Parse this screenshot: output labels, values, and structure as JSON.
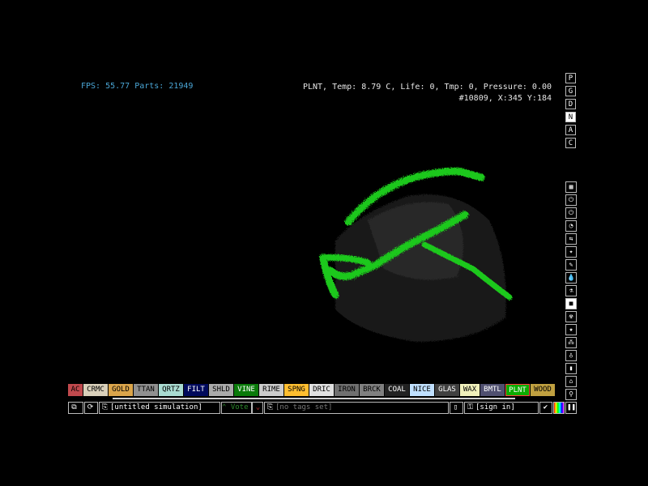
{
  "hud": {
    "fps_label": "FPS:",
    "fps_value": "55.77",
    "parts_label": "Parts:",
    "parts_value": "21949",
    "info_line1": "PLNT, Temp: 8.79 C, Life: 0, Tmp: 0, Pressure: 0.00",
    "info_line2": "#10809, X:345 Y:184"
  },
  "render_modes": [
    "P",
    "G",
    "D",
    "N",
    "A",
    "C"
  ],
  "categories": [
    {
      "name": "walls-icon",
      "glyph": "▦"
    },
    {
      "name": "electronics-icon",
      "glyph": "⏻"
    },
    {
      "name": "powered-icon",
      "glyph": "⏻"
    },
    {
      "name": "sensors-icon",
      "glyph": "◔"
    },
    {
      "name": "force-icon",
      "glyph": "⇆"
    },
    {
      "name": "explosives-icon",
      "glyph": "✦"
    },
    {
      "name": "gases-icon",
      "glyph": "✎"
    },
    {
      "name": "liquids-icon",
      "glyph": "💧"
    },
    {
      "name": "powders-icon",
      "glyph": "⚗"
    },
    {
      "name": "solids-icon",
      "glyph": "■"
    },
    {
      "name": "radioactive-icon",
      "glyph": "☢"
    },
    {
      "name": "special-icon",
      "glyph": "★"
    },
    {
      "name": "life-icon",
      "glyph": "⁂"
    },
    {
      "name": "tools-icon",
      "glyph": "♁"
    },
    {
      "name": "favorites-icon",
      "glyph": "▮"
    },
    {
      "name": "decoration-icon",
      "glyph": "⌂"
    },
    {
      "name": "search-icon",
      "glyph": "⚲"
    }
  ],
  "elements": [
    {
      "label": "AC",
      "bg": "#c0494d",
      "fg": "#000000"
    },
    {
      "label": "CRMC",
      "bg": "#d9d0ba",
      "fg": "#000000"
    },
    {
      "label": "GOLD",
      "bg": "#dba54b",
      "fg": "#000000"
    },
    {
      "label": "TTAN",
      "bg": "#909090",
      "fg": "#000000"
    },
    {
      "label": "QRTZ",
      "bg": "#a9dbd1",
      "fg": "#000000"
    },
    {
      "label": "FILT",
      "bg": "#000a5c",
      "fg": "#ffffff"
    },
    {
      "label": "SHLD",
      "bg": "#aaaaaa",
      "fg": "#000000"
    },
    {
      "label": "VINE",
      "bg": "#0a7a0a",
      "fg": "#ffffff"
    },
    {
      "label": "RIME",
      "bg": "#cccccc",
      "fg": "#000000"
    },
    {
      "label": "SPNG",
      "bg": "#ffbe30",
      "fg": "#000000"
    },
    {
      "label": "DRIC",
      "bg": "#e0e0e0",
      "fg": "#000000"
    },
    {
      "label": "IRON",
      "bg": "#707070",
      "fg": "#000000"
    },
    {
      "label": "BRCK",
      "bg": "#808080",
      "fg": "#000000"
    },
    {
      "label": "COAL",
      "bg": "#222222",
      "fg": "#ffffff"
    },
    {
      "label": "NICE",
      "bg": "#c0e0ff",
      "fg": "#000000"
    },
    {
      "label": "GLAS",
      "bg": "#404040",
      "fg": "#ffffff"
    },
    {
      "label": "WAX",
      "bg": "#f0f0bb",
      "fg": "#000000"
    },
    {
      "label": "BMTL",
      "bg": "#505070",
      "fg": "#ffffff"
    },
    {
      "label": "PLNT",
      "bg": "#0cac00",
      "fg": "#ffffff",
      "selected": true
    },
    {
      "label": "WOOD",
      "bg": "#c0a040",
      "fg": "#000000"
    }
  ],
  "bottom": {
    "sim_name": "[untitled simulation]",
    "vote_label": "Vote",
    "tags_placeholder": "[no tags set]",
    "signin_label": "[sign in]"
  }
}
